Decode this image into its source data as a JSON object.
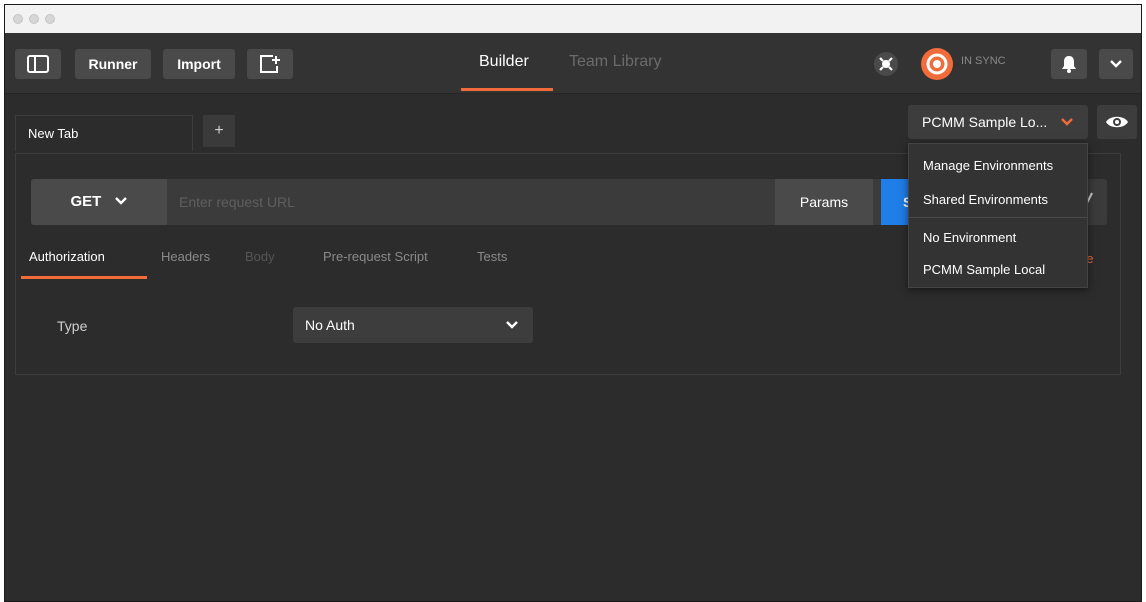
{
  "toolbar": {
    "runner_label": "Runner",
    "import_label": "Import",
    "tabs": [
      {
        "label": "Builder"
      },
      {
        "label": "Team Library"
      }
    ],
    "sync_status": "IN SYNC"
  },
  "tab_bar": {
    "tabs": [
      {
        "label": "New Tab"
      }
    ],
    "add_tab_label": "+"
  },
  "environment": {
    "selected": "PCMM Sample Lo...",
    "dropdown_items": [
      {
        "label": "Manage Environments"
      },
      {
        "label": "Shared Environments"
      },
      {
        "label": "No Environment"
      },
      {
        "label": "PCMM Sample Local"
      }
    ]
  },
  "request": {
    "method": "GET",
    "url_placeholder": "Enter request URL",
    "params_label": "Params",
    "send_label_partial": "S",
    "tabs": [
      {
        "label": "Authorization"
      },
      {
        "label": "Headers"
      },
      {
        "label": "Body"
      },
      {
        "label": "Pre-request Script"
      },
      {
        "label": "Tests"
      }
    ],
    "code_link_partial": "de"
  },
  "auth": {
    "type_label": "Type",
    "type_value": "No Auth"
  },
  "colors": {
    "accent": "#f26b3a",
    "send_blue": "#1f7ee8",
    "background": "#2c2c2c"
  }
}
